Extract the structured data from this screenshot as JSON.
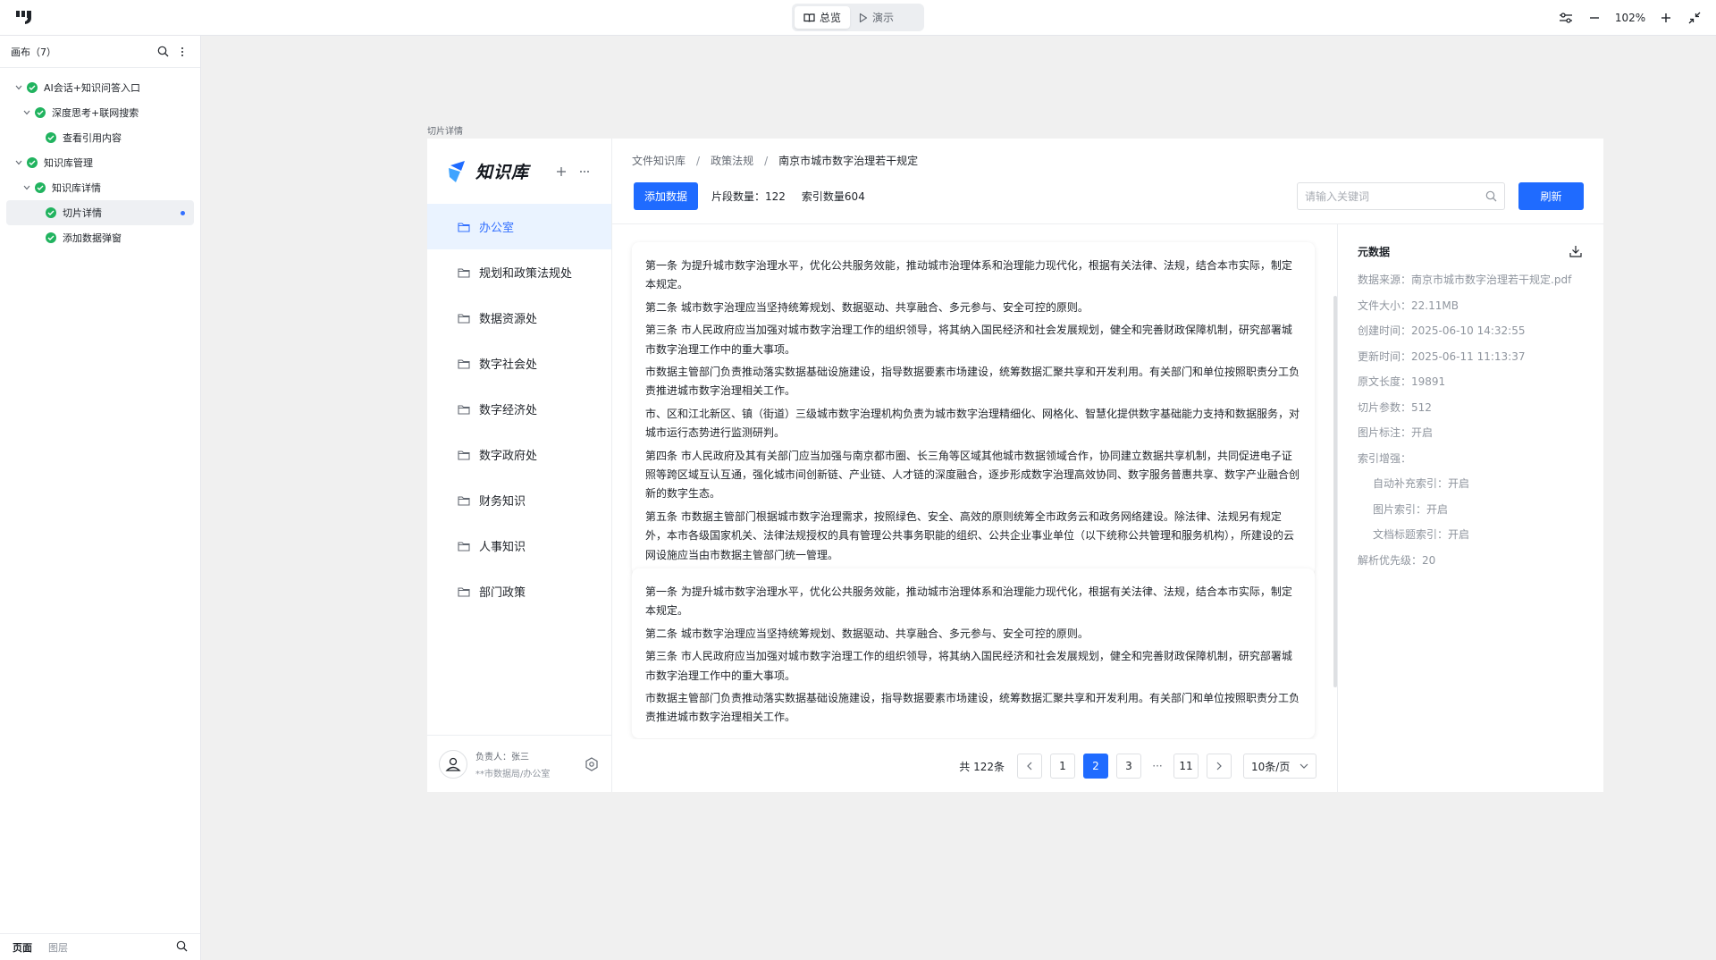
{
  "topbar": {
    "modes": [
      {
        "label": "总览",
        "active": true
      },
      {
        "label": "演示",
        "active": false
      }
    ],
    "zoom": "102%"
  },
  "left_panel": {
    "title": "画布（7）",
    "tree": [
      {
        "label": "AI会话+知识问答入口",
        "level": 0,
        "expanded": true,
        "selected": false
      },
      {
        "label": "深度思考+联网搜索",
        "level": 1,
        "expanded": true,
        "selected": false
      },
      {
        "label": "查看引用内容",
        "level": 2,
        "expanded": false,
        "selected": false
      },
      {
        "label": "知识库管理",
        "level": 0,
        "expanded": true,
        "selected": false
      },
      {
        "label": "知识库详情",
        "level": 1,
        "expanded": true,
        "selected": false
      },
      {
        "label": "切片详情",
        "level": 2,
        "expanded": false,
        "selected": true
      },
      {
        "label": "添加数据弹窗",
        "level": 2,
        "expanded": false,
        "selected": false
      }
    ],
    "footer_tabs": [
      {
        "label": "页面",
        "active": true
      },
      {
        "label": "图层",
        "active": false
      }
    ]
  },
  "frame": {
    "label": "切片详情",
    "kb": {
      "title": "知识库",
      "departments": [
        {
          "label": "办公室",
          "active": true
        },
        {
          "label": "规划和政策法规处",
          "active": false
        },
        {
          "label": "数据资源处",
          "active": false
        },
        {
          "label": "数字社会处",
          "active": false
        },
        {
          "label": "数字经济处",
          "active": false
        },
        {
          "label": "数字政府处",
          "active": false
        },
        {
          "label": "财务知识",
          "active": false
        },
        {
          "label": "人事知识",
          "active": false
        },
        {
          "label": "部门政策",
          "active": false
        }
      ],
      "user": {
        "owner": "负责人：张三",
        "dept": "**市数据局/办公室"
      }
    },
    "breadcrumb": [
      "文件知识库",
      "政策法规",
      "南京市城市数字治理若干规定"
    ],
    "toolbar": {
      "add_label": "添加数据",
      "segments": "片段数量：122",
      "index": "索引数量604",
      "search_placeholder": "请输入关键词",
      "refresh_label": "刷新"
    },
    "chunks": [
      {
        "paragraphs": [
          "第一条 为提升城市数字治理水平，优化公共服务效能，推动城市治理体系和治理能力现代化，根据有关法律、法规，结合本市实际，制定本规定。",
          "第二条 城市数字治理应当坚持统筹规划、数据驱动、共享融合、多元参与、安全可控的原则。",
          "第三条 市人民政府应当加强对城市数字治理工作的组织领导，将其纳入国民经济和社会发展规划，健全和完善财政保障机制，研究部署城市数字治理工作中的重大事项。",
          "市数据主管部门负责推动落实数据基础设施建设，指导数据要素市场建设，统筹数据汇聚共享和开发利用。有关部门和单位按照职责分工负责推进城市数字治理相关工作。",
          "市、区和江北新区、镇（街道）三级城市数字治理机构负责为城市数字治理精细化、网格化、智慧化提供数字基础能力支持和数据服务，对城市运行态势进行监测研判。",
          "第四条 市人民政府及其有关部门应当加强与南京都市圈、长三角等区域其他城市数据领域合作，协同建立数据共享机制，共同促进电子证照等跨区域互认互通，强化城市间创新链、产业链、人才链的深度融合，逐步形成数字治理高效协同、数字服务普惠共享、数字产业融合创新的数字生态。",
          "第五条 市数据主管部门根据城市数字治理需求，按照绿色、安全、高效的原则统筹全市政务云和政务网络建设。除法律、法规另有规定外，本市各级国家机关、法律法规授权的具有管理公共事务职能的组织、公共企业事业单位（以下统称公共管理和服务机构），所建设的云网设施应当由市数据主管部门统一管理。"
        ]
      },
      {
        "paragraphs": [
          "第一条 为提升城市数字治理水平，优化公共服务效能，推动城市治理体系和治理能力现代化，根据有关法律、法规，结合本市实际，制定本规定。",
          "第二条 城市数字治理应当坚持统筹规划、数据驱动、共享融合、多元参与、安全可控的原则。",
          "第三条 市人民政府应当加强对城市数字治理工作的组织领导，将其纳入国民经济和社会发展规划，健全和完善财政保障机制，研究部署城市数字治理工作中的重大事项。",
          "市数据主管部门负责推动落实数据基础设施建设，指导数据要素市场建设，统筹数据汇聚共享和开发利用。有关部门和单位按照职责分工负责推进城市数字治理相关工作。"
        ]
      }
    ],
    "pagination": {
      "total": "共 122条",
      "pages": [
        "1",
        "2",
        "3"
      ],
      "current": "2",
      "ellipsis": "···",
      "last": "11",
      "page_size": "10条/页"
    },
    "metadata": {
      "title": "元数据",
      "rows": [
        {
          "label": "数据来源：",
          "value": "南京市城市数字治理若干规定.pdf",
          "sub": false
        },
        {
          "label": "文件大小：",
          "value": "22.11MB",
          "sub": false
        },
        {
          "label": "创建时间：",
          "value": "2025-06-10 14:32:55",
          "sub": false
        },
        {
          "label": "更新时间：",
          "value": "2025-06-11 11:13:37",
          "sub": false
        },
        {
          "label": "原文长度：",
          "value": "19891",
          "sub": false
        },
        {
          "label": "切片参数：",
          "value": "512",
          "sub": false
        },
        {
          "label": "图片标注：",
          "value": "开启",
          "sub": false
        },
        {
          "label": "索引增强：",
          "value": "",
          "sub": false
        },
        {
          "label": "自动补充索引：",
          "value": "开启",
          "sub": true
        },
        {
          "label": "图片索引：",
          "value": "开启",
          "sub": true
        },
        {
          "label": "文档标题索引：",
          "value": "开启",
          "sub": true
        },
        {
          "label": "解析优先级：",
          "value": "20",
          "sub": false
        }
      ]
    }
  }
}
